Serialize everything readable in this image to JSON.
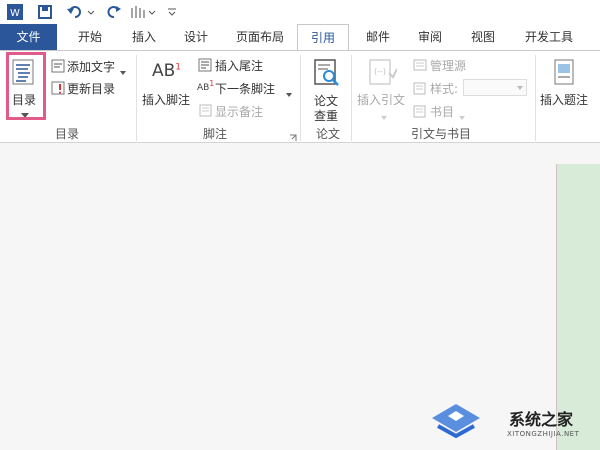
{
  "qat": {
    "icons": [
      "word-app-icon",
      "save-icon",
      "undo-icon",
      "redo-icon",
      "touch-mode-icon",
      "customize-qat-icon"
    ]
  },
  "tabs": [
    "文件",
    "开始",
    "插入",
    "设计",
    "页面布局",
    "引用",
    "邮件",
    "审阅",
    "视图",
    "开发工具"
  ],
  "active_tab": "引用",
  "ribbon": {
    "toc": {
      "button": "目录",
      "add_text": "添加文字",
      "update": "更新目录",
      "group": "目录"
    },
    "footnotes": {
      "insert_footnote": "插入脚注",
      "insert_endnote": "插入尾注",
      "next_footnote": "下一条脚注",
      "show_notes": "显示备注",
      "group": "脚注"
    },
    "paper": {
      "button_line1": "论文",
      "button_line2": "查重",
      "group": "论文"
    },
    "citations": {
      "insert_citation": "插入引文",
      "manage_sources": "管理源",
      "style": "样式:",
      "bibliography": "书目",
      "group": "引文与书目"
    },
    "captions": {
      "insert_caption": "插入题注"
    }
  },
  "watermark": {
    "brand": "系统之家",
    "url": "XITONGZHIJIA.NET"
  },
  "colors": {
    "accent": "#2b579a",
    "highlight": "#e05a8a",
    "page": "#d7ebd8"
  }
}
